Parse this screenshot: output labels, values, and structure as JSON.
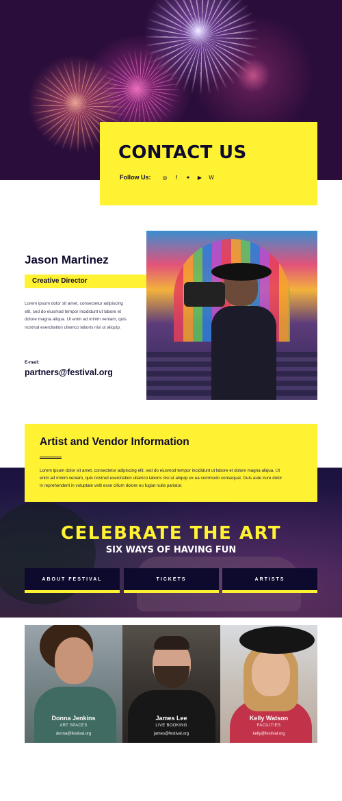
{
  "hero": {
    "title": "CONTACT US",
    "follow_label": "Follow Us:",
    "social_icons": [
      "instagram-icon",
      "facebook-icon",
      "twitter-icon",
      "youtube-icon",
      "wordpress-icon"
    ],
    "social_glyphs": [
      "◎",
      "f",
      "✦",
      "▶",
      "W"
    ]
  },
  "profile": {
    "name": "Jason Martinez",
    "role": "Creative Director",
    "bio": "Lorem ipsum dolor sit amet, consectetur adipiscing elit, sed do eiusmod tempor incididunt ut labore et dolore magna aliqua. Ut enim ad minim veniam, quis nostrud exercitation ullamco laboris nisi ut aliquip.",
    "email_label": "E-mail:",
    "email": "partners@festival.org"
  },
  "vendor": {
    "title": "Artist and Vendor Information",
    "text": "Lorem ipsum dolor sit amet, consectetur adipiscing elit, sed do eiusmod tempor incididunt ut labore et dolore magna aliqua. Ut enim ad minim veniam, quis nostrud exercitation ullamco laboris nisi ut aliquip ex ea commodo consequat. Duis aute irure dolor in reprehenderit in voluptate velit esse cillum dolore eu fugiat nulla pariatur."
  },
  "celebrate": {
    "title": "CELEBRATE THE ART",
    "subtitle": "SIX WAYS OF HAVING FUN",
    "buttons": [
      "ABOUT FESTIVAL",
      "TICKETS",
      "ARTISTS"
    ]
  },
  "team": [
    {
      "name": "Donna Jenkins",
      "role": "ART SPACES",
      "email": "donna@festival.org"
    },
    {
      "name": "James Lee",
      "role": "LIVE BOOKING",
      "email": "james@festival.org"
    },
    {
      "name": "Kelly Watson",
      "role": "FACILITIES",
      "email": "kelly@festival.org"
    }
  ],
  "colors": {
    "accent": "#fff233",
    "navy": "#0d0a2e"
  }
}
